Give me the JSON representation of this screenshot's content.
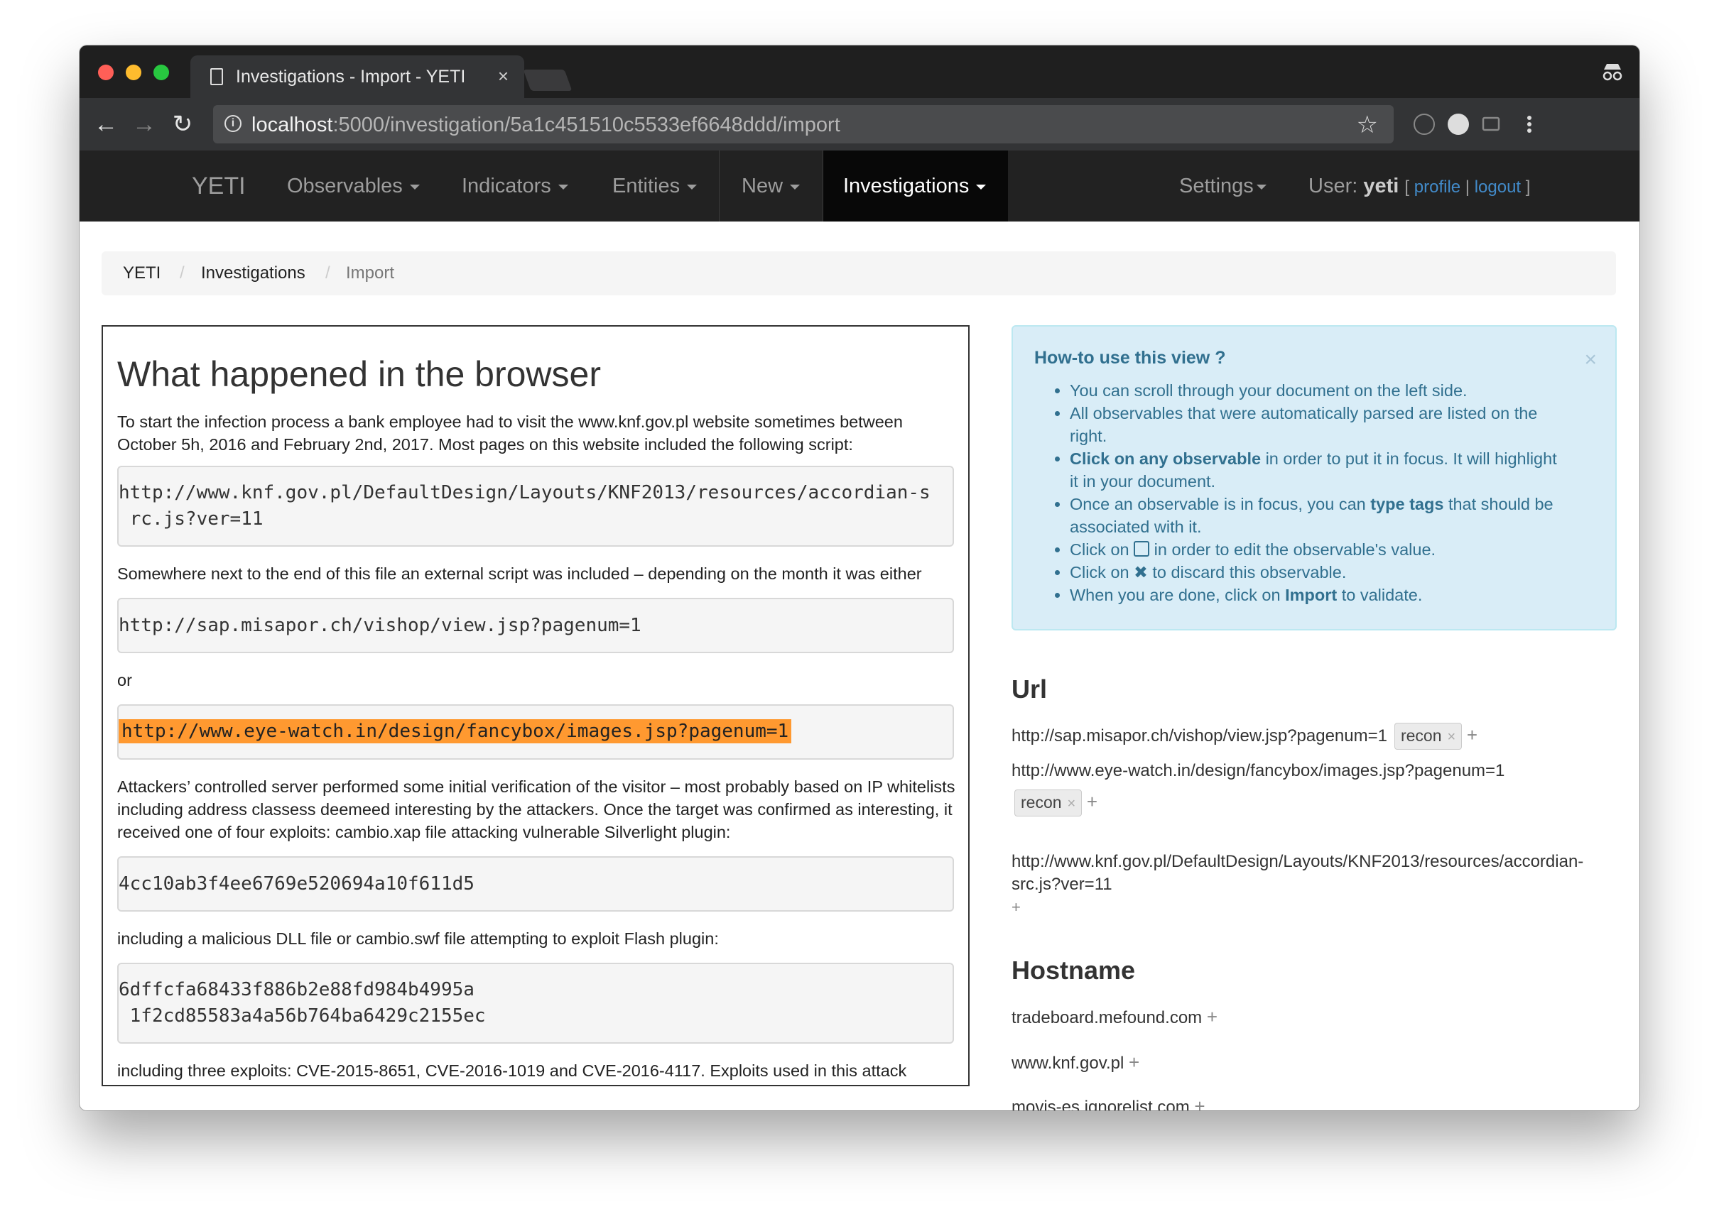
{
  "browser": {
    "tab_title": "Investigations - Import - YETI",
    "tab_close": "×",
    "url_host": "localhost",
    "url_path": ":5000/investigation/5a1c451510c5533ef6648ddd/import"
  },
  "navbar": {
    "brand": "YETI",
    "items": [
      {
        "label": "Observables"
      },
      {
        "label": "Indicators"
      },
      {
        "label": "Entities"
      },
      {
        "label": "New"
      },
      {
        "label": "Investigations"
      }
    ],
    "settings": "Settings",
    "user_prefix": "User:",
    "user_name": "yeti",
    "bracket_open": "[",
    "profile": "profile",
    "pipe": "|",
    "logout": "logout",
    "bracket_close": "]"
  },
  "breadcrumb": {
    "items": [
      "YETI",
      "Investigations",
      "Import"
    ],
    "separator": "/"
  },
  "document": {
    "heading": "What happened in the browser",
    "p1": "To start the infection process a bank employee had to visit the www.knf.gov.pl website sometimes between October 5h, 2016 and February 2nd, 2017. Most pages on this website included the following script:",
    "code1_line1": "http://www.knf.gov.pl/DefaultDesign/Layouts/KNF2013/resources/accordian-s",
    "code1_line2": " rc.js?ver=11",
    "p2": "Somewhere next to the end of this file an external script was included – depending on the month it was either",
    "code2": "http://sap.misapor.ch/vishop/view.jsp?pagenum=1",
    "p3": "or",
    "code3": "http://www.eye-watch.in/design/fancybox/images.jsp?pagenum=1",
    "p4": "Attackers’ controlled server performed some initial verification of the visitor – most probably based on IP whitelists including address classess deemeed interesting by the attackers. Once the target was confirmed as interesting, it received one of four exploits: cambio.xap file attacking vulnerable Silverlight plugin:",
    "code4": "4cc10ab3f4ee6769e520694a10f611d5",
    "p5": "including a malicious DLL file or cambio.swf file attempting to exploit Flash plugin:",
    "code5_line1": "6dffcfa68433f886b2e88fd984b4995a",
    "code5_line2": " 1f2cd85583a4a56b764ba6429c2155ec",
    "p6": "including three exploits: CVE-2015-8651, CVE-2016-1019 and CVE-2016-4117. Exploits used in this attack"
  },
  "howto": {
    "title": "How-to use this view ?",
    "close": "×",
    "li1": "You can scroll through your document on the left side.",
    "li2": "All observables that were automatically parsed are listed on the right.",
    "li3_bold": "Click on any observable",
    "li3_rest": " in order to put it in focus. It will highlight it in your document.",
    "li4_a": "Once an observable is in focus, you can ",
    "li4_bold": "type tags",
    "li4_b": " that should be associated with it.",
    "li5_a": "Click on ",
    "li5_b": " in order to edit the observable's value.",
    "li6_a": "Click on ",
    "li6_icon": "✖",
    "li6_b": " to discard this observable.",
    "li7_a": "When you are done, click on ",
    "li7_bold": "Import",
    "li7_b": " to validate."
  },
  "observables": {
    "url_heading": "Url",
    "urls": [
      {
        "value": "http://sap.misapor.ch/vishop/view.jsp?pagenum=1",
        "tag": "recon"
      },
      {
        "value": "http://www.eye-watch.in/design/fancybox/images.jsp?pagenum=1",
        "tag": "recon"
      },
      {
        "value": "http://www.knf.gov.pl/DefaultDesign/Layouts/KNF2013/resources/accordian-src.js?ver=11"
      }
    ],
    "hostname_heading": "Hostname",
    "hostnames": [
      "tradeboard.mefound.com",
      "www.knf.gov.pl",
      "movis-es.ignorelist.com"
    ],
    "tag_remove": "×",
    "add": "+"
  },
  "colors": {
    "highlight": "#ff9930",
    "navbar_bg": "#222222",
    "alert_bg": "#d9edf7",
    "link": "#428bca"
  }
}
